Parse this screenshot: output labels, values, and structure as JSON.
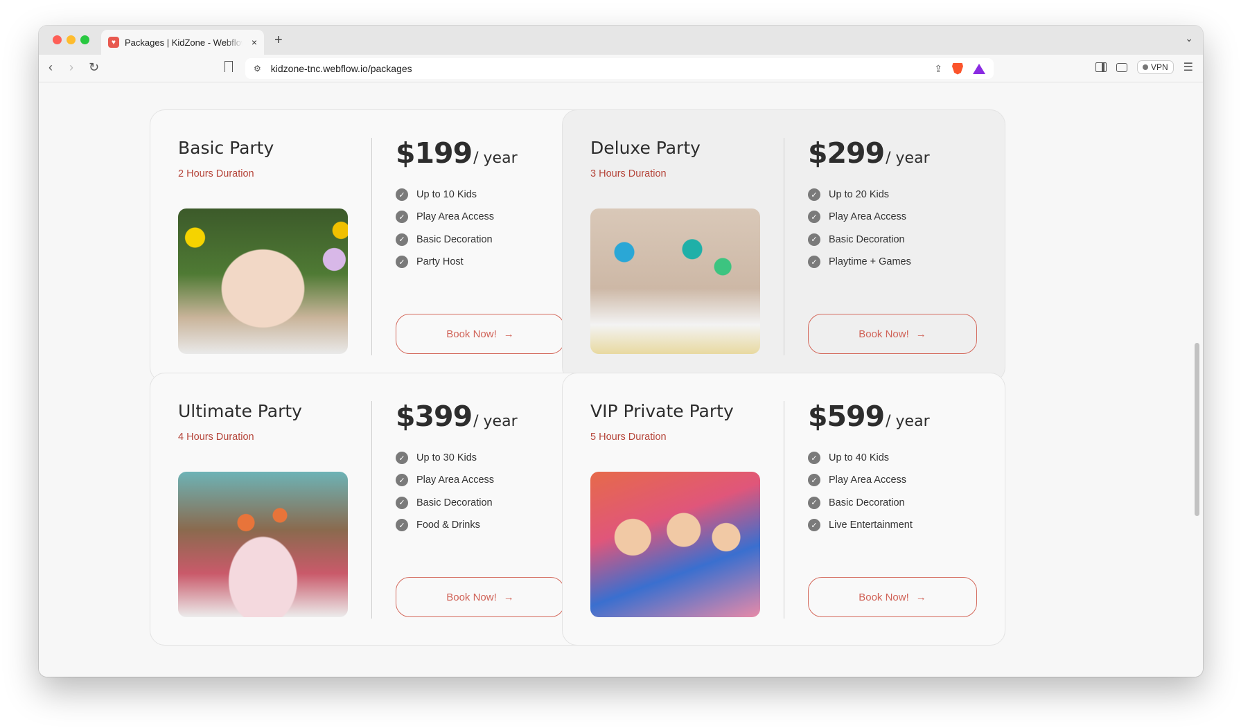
{
  "browser": {
    "tab_title": "Packages | KidZone - Webflow",
    "tab_favicon": "kidzone-favicon",
    "url": "kidzone-tnc.webflow.io/packages",
    "vpn_label": "VPN",
    "new_tab_label": "+",
    "close_label": "×"
  },
  "packages": [
    {
      "name": "Basic Party",
      "duration": "2 Hours Duration",
      "price": "$199",
      "period": "/ year",
      "features": [
        "Up to 10 Kids",
        "Play Area Access",
        "Basic Decoration",
        "Party Host"
      ],
      "button": "Book Now!",
      "image_alt": "Kids celebrating outdoors with balloons and party hats"
    },
    {
      "name": "Deluxe Party",
      "duration": "3 Hours Duration",
      "price": "$299",
      "period": "/ year",
      "features": [
        "Up to 20 Kids",
        "Play Area Access",
        "Basic Decoration",
        "Playtime + Games"
      ],
      "button": "Book Now!",
      "image_alt": "Kids at a decorated party table with a cake"
    },
    {
      "name": "Ultimate Party",
      "duration": "4 Hours Duration",
      "price": "$399",
      "period": "/ year",
      "features": [
        "Up to 30 Kids",
        "Play Area Access",
        "Basic Decoration",
        "Food & Drinks"
      ],
      "button": "Book Now!",
      "image_alt": "Kids toasting with cups around a birthday cake"
    },
    {
      "name": "VIP Private Party",
      "duration": "5 Hours Duration",
      "price": "$599",
      "period": "/ year",
      "features": [
        "Up to 40 Kids",
        "Play Area Access",
        "Basic Decoration",
        "Live Entertainment"
      ],
      "button": "Book Now!",
      "image_alt": "Excited kids in party hats cheering"
    }
  ],
  "colors": {
    "accent": "#d06257",
    "duration_text": "#b5453a",
    "check": "#7a7a7a"
  }
}
